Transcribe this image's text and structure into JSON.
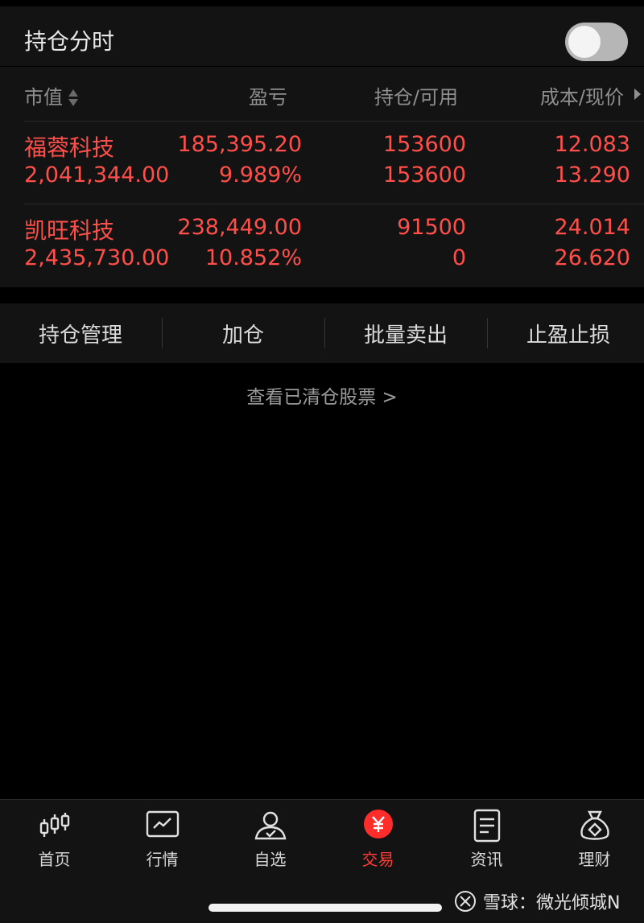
{
  "header": {
    "title": "持仓分时",
    "toggle_on": false
  },
  "columns": {
    "market_value": "市值",
    "pnl": "盈亏",
    "position": "持仓/可用",
    "cost_price": "成本/现价"
  },
  "positions": [
    {
      "name": "福蓉科技",
      "market_value": "2,041,344.00",
      "pnl": "185,395.20",
      "pnl_pct": "9.989%",
      "holding": "153600",
      "available": "153600",
      "cost": "12.083",
      "price": "13.290"
    },
    {
      "name": "凯旺科技",
      "market_value": "2,435,730.00",
      "pnl": "238,449.00",
      "pnl_pct": "10.852%",
      "holding": "91500",
      "available": "0",
      "cost": "24.014",
      "price": "26.620"
    }
  ],
  "actions": [
    "持仓管理",
    "加仓",
    "批量卖出",
    "止盈止损"
  ],
  "cleared_link": "查看已清仓股票 >",
  "tabs": [
    {
      "label": "首页",
      "icon": "candlestick-icon"
    },
    {
      "label": "行情",
      "icon": "chart-icon"
    },
    {
      "label": "自选",
      "icon": "user-check-icon"
    },
    {
      "label": "交易",
      "icon": "yen-icon",
      "active": true
    },
    {
      "label": "资讯",
      "icon": "document-icon"
    },
    {
      "label": "理财",
      "icon": "money-bag-icon"
    }
  ],
  "watermark": "雪球：微光倾城N",
  "colors": {
    "up": "#ff4f4a",
    "active_tab": "#ff3b36",
    "panel": "#131313",
    "background": "#000000"
  }
}
